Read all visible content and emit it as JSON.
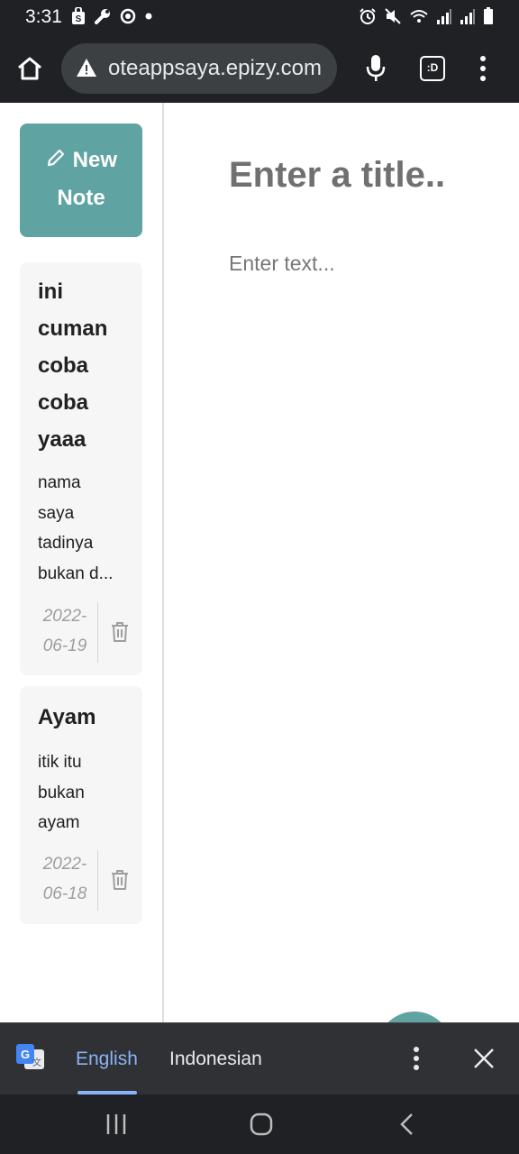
{
  "status_bar": {
    "time": "3:31",
    "left_icons": [
      "shopping-bag-icon",
      "wrench-icon",
      "sync-icon",
      "dot-icon"
    ],
    "right_icons": [
      "alarm-icon",
      "mute-icon",
      "wifi-icon",
      "signal-icon",
      "signal-icon",
      "battery-icon"
    ]
  },
  "browser": {
    "url": "oteappsaya.epizy.com",
    "tab_switcher": ":D"
  },
  "sidebar": {
    "new_note_label": "New Note",
    "notes": [
      {
        "title": [
          "ini",
          "cuman",
          "coba",
          "coba",
          "yaaa"
        ],
        "body": [
          "nama",
          "saya",
          "tadinya",
          "bukan d..."
        ],
        "date": [
          "2022-",
          "06-19"
        ]
      },
      {
        "title": [
          "Ayam"
        ],
        "body": [
          "itik itu",
          "bukan",
          "ayam"
        ],
        "date": [
          "2022-",
          "06-18"
        ]
      }
    ]
  },
  "editor": {
    "title_placeholder": "Enter a title..",
    "text_placeholder": "Enter text..."
  },
  "translate_bar": {
    "source_language": "English",
    "target_language": "Indonesian"
  },
  "colors": {
    "accent": "#5fa3a3",
    "chrome_dark": "#202124",
    "translate_blue": "#8ab4f8"
  }
}
